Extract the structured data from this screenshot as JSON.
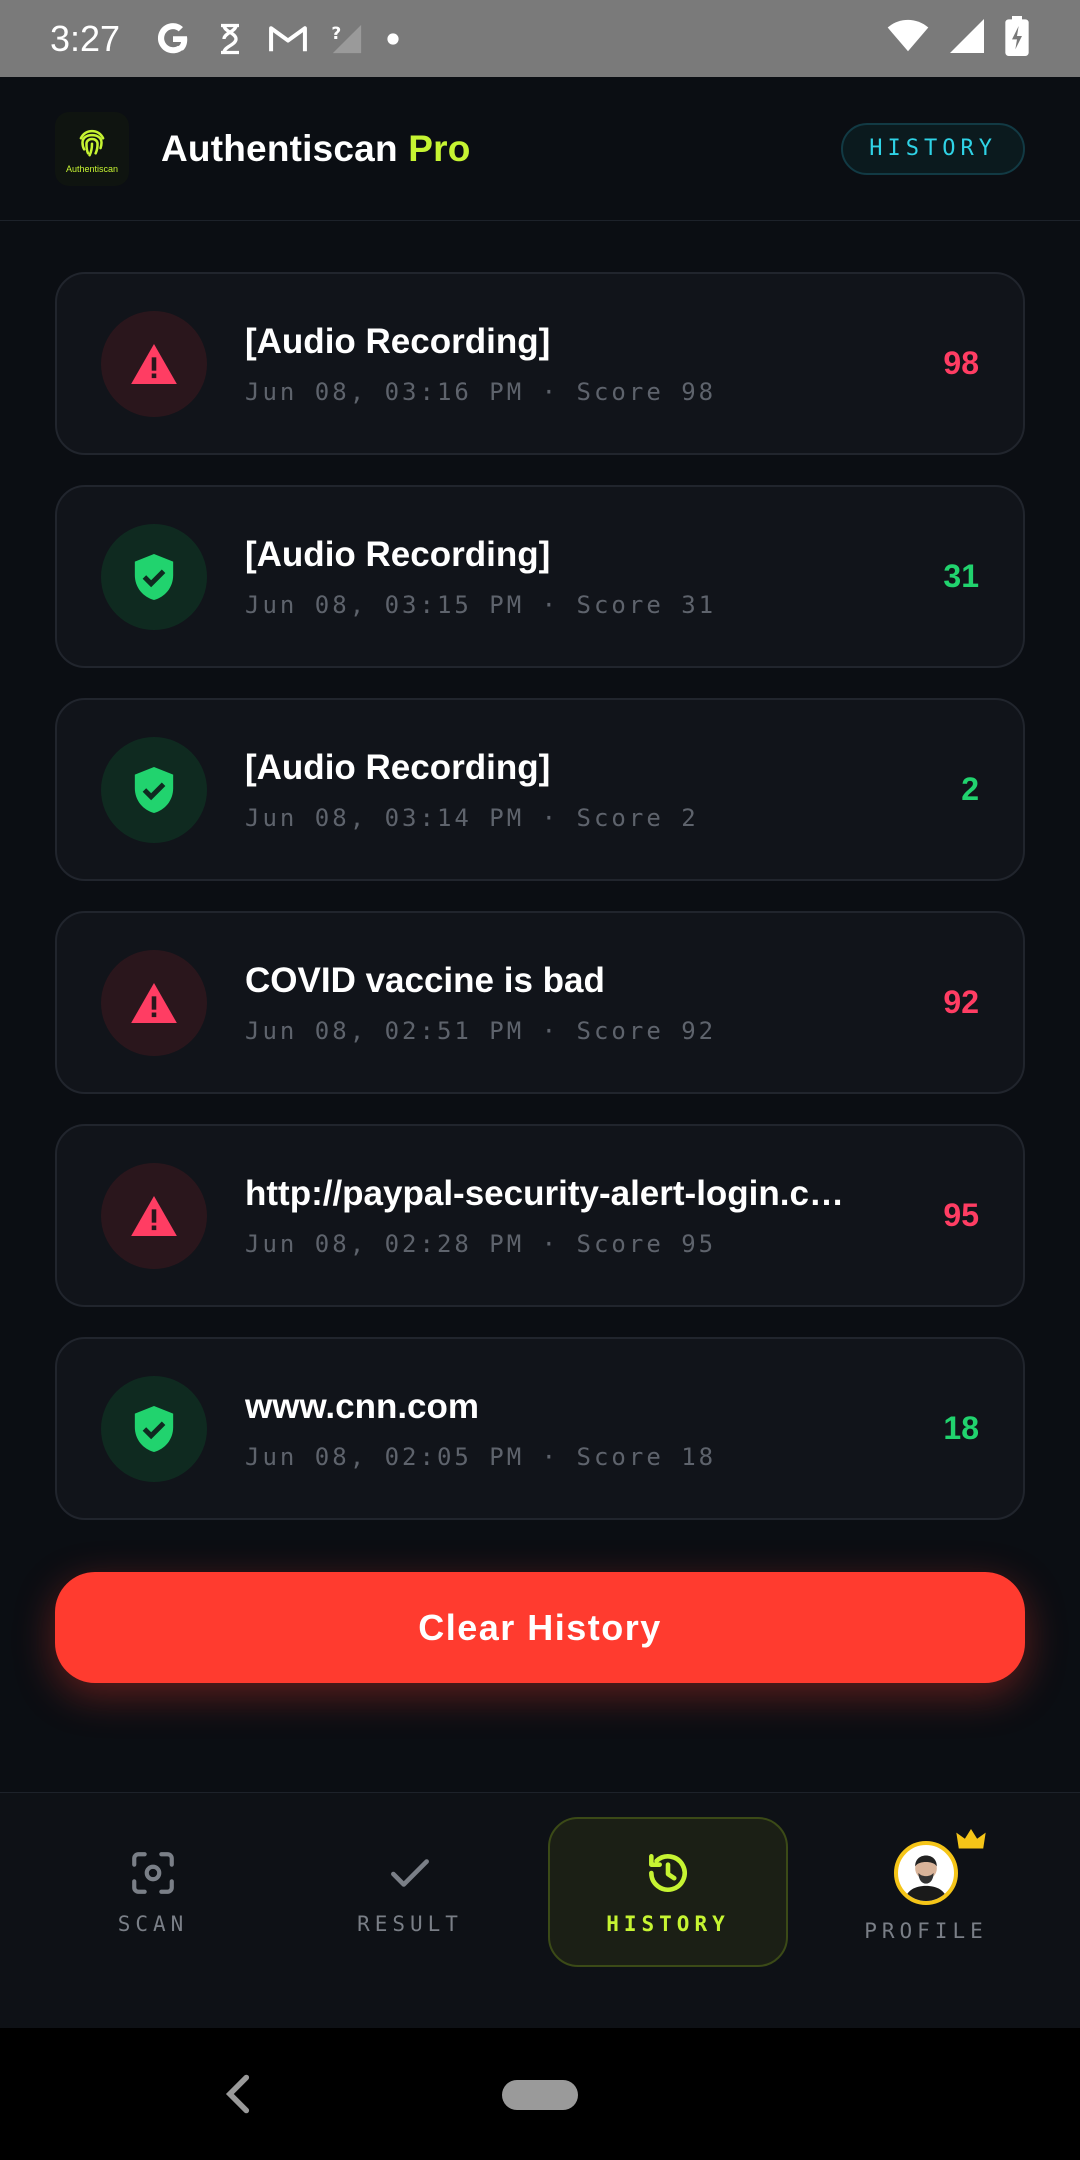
{
  "status_bar": {
    "time": "3:27",
    "left_icons": [
      "google-icon",
      "authenticator-icon",
      "gmail-icon",
      "no-signal-icon",
      "dot-icon"
    ],
    "right_icons": [
      "wifi-icon",
      "signal-icon",
      "battery-charging-icon"
    ]
  },
  "header": {
    "logo_text": "Authentiscan",
    "title_main": "Authentiscan",
    "title_accent": "Pro",
    "history_pill": "HISTORY",
    "accent_color": "#c6f432"
  },
  "history": [
    {
      "title": "[Audio Recording]",
      "subtitle": "Jun 08, 03:16 PM · Score 98",
      "score": "98",
      "status": "danger"
    },
    {
      "title": "[Audio Recording]",
      "subtitle": "Jun 08, 03:15 PM · Score 31",
      "score": "31",
      "status": "safe"
    },
    {
      "title": "[Audio Recording]",
      "subtitle": "Jun 08, 03:14 PM · Score 2",
      "score": "2",
      "status": "safe"
    },
    {
      "title": "COVID vaccine is bad",
      "subtitle": "Jun 08, 02:51 PM · Score 92",
      "score": "92",
      "status": "danger"
    },
    {
      "title": "http://paypal-security-alert-login.c…",
      "subtitle": "Jun 08, 02:28 PM · Score 95",
      "score": "95",
      "status": "danger"
    },
    {
      "title": "www.cnn.com",
      "subtitle": "Jun 08, 02:05 PM · Score 18",
      "score": "18",
      "status": "safe"
    }
  ],
  "colors": {
    "danger": "#ff3d63",
    "safe": "#21d36e",
    "clear_button": "#ff3b2f"
  },
  "clear_button": "Clear History",
  "nav": {
    "scan": "SCAN",
    "result": "RESULT",
    "history": "HISTORY",
    "profile": "PROFILE",
    "active": "history"
  }
}
